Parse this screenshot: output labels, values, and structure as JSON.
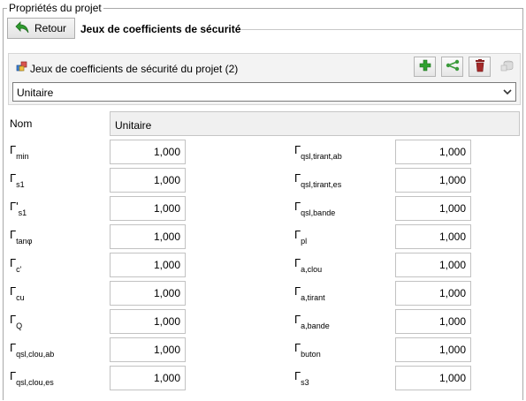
{
  "group": {
    "legend": "Propriétés du projet"
  },
  "header": {
    "back_label": "Retour",
    "title": "Jeux de coefficients de sécurité"
  },
  "panel": {
    "label": "Jeux de coefficients de sécurité du projet (2)",
    "toolbar": [
      {
        "name": "add-icon",
        "enabled": true
      },
      {
        "name": "share-icon",
        "enabled": true
      },
      {
        "name": "delete-icon",
        "enabled": true
      },
      {
        "name": "copy-icon",
        "enabled": false
      }
    ],
    "selected_set": "Unitaire"
  },
  "form": {
    "name_label": "Nom",
    "name_value": "Unitaire",
    "left": [
      {
        "symbol": "Γ",
        "sub": "min",
        "value": "1,000"
      },
      {
        "symbol": "Γ",
        "sub": "s1",
        "value": "1,000"
      },
      {
        "symbol": "Γ'",
        "sub": "s1",
        "value": "1,000"
      },
      {
        "symbol": "Γ",
        "sub": "tanφ",
        "value": "1,000"
      },
      {
        "symbol": "Γ",
        "sub": "c'",
        "value": "1,000"
      },
      {
        "symbol": "Γ",
        "sub": "cu",
        "value": "1,000"
      },
      {
        "symbol": "Γ",
        "sub": "Q",
        "value": "1,000"
      },
      {
        "symbol": "Γ",
        "sub": "qsl,clou,ab",
        "value": "1,000"
      },
      {
        "symbol": "Γ",
        "sub": "qsl,clou,es",
        "value": "1,000"
      }
    ],
    "right": [
      {
        "symbol": "Γ",
        "sub": "qsl,tirant,ab",
        "value": "1,000"
      },
      {
        "symbol": "Γ",
        "sub": "qsl,tirant,es",
        "value": "1,000"
      },
      {
        "symbol": "Γ",
        "sub": "qsl,bande",
        "value": "1,000"
      },
      {
        "symbol": "Γ",
        "sub": "pl",
        "value": "1,000"
      },
      {
        "symbol": "Γ",
        "sub": "a,clou",
        "value": "1,000"
      },
      {
        "symbol": "Γ",
        "sub": "a,tirant",
        "value": "1,000"
      },
      {
        "symbol": "Γ",
        "sub": "a,bande",
        "value": "1,000"
      },
      {
        "symbol": "Γ",
        "sub": "buton",
        "value": "1,000"
      },
      {
        "symbol": "Γ",
        "sub": "s3",
        "value": "1,000"
      }
    ]
  }
}
